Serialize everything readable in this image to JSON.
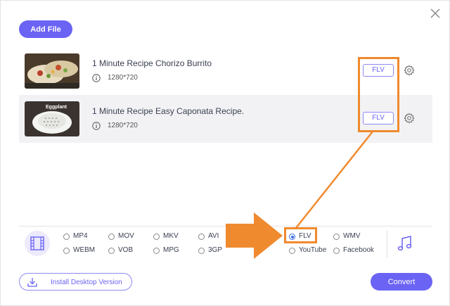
{
  "toolbar": {
    "add_file_label": "Add File"
  },
  "files": [
    {
      "title": "1 Minute Recipe Chorizo Burrito",
      "resolution": "1280*720",
      "format": "FLV"
    },
    {
      "title": "1 Minute Recipe Easy Caponata Recipe.",
      "resolution": "1280*720",
      "format": "FLV"
    }
  ],
  "thumbnails": [
    {
      "caption": ""
    },
    {
      "caption": "Eggplant"
    }
  ],
  "formats": {
    "row1": [
      "MP4",
      "MOV",
      "MKV",
      "AVI",
      "FLV",
      "WMV"
    ],
    "row2": [
      "WEBM",
      "VOB",
      "MPG",
      "3GP",
      "YouTube",
      "Facebook"
    ],
    "selected": "FLV"
  },
  "footer": {
    "install_label": "Install Desktop Version",
    "convert_label": "Convert"
  },
  "colors": {
    "accent": "#6b63f4",
    "highlight": "#f08a2e",
    "radio_selected": "#3b6ee8"
  }
}
